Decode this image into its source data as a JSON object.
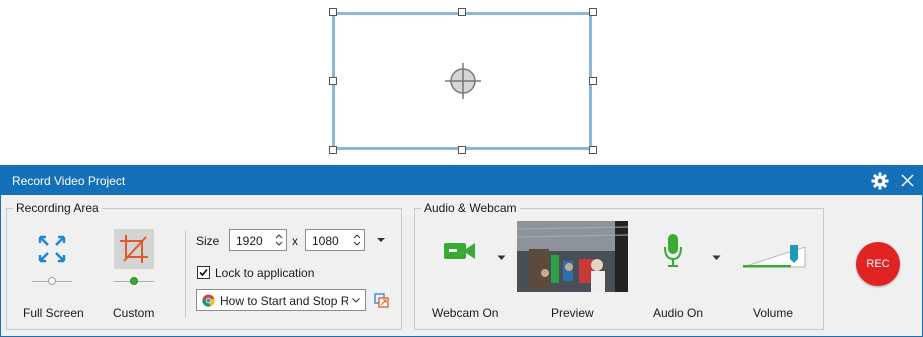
{
  "window": {
    "title": "Record Video Project",
    "settings_icon": "gear-icon",
    "close_icon": "close-icon"
  },
  "recording_area": {
    "group_label": "Recording Area",
    "full_screen_label": "Full Screen",
    "custom_label": "Custom",
    "size_label": "Size",
    "width_value": "1920",
    "x_separator": "x",
    "height_value": "1080",
    "lock_checked": true,
    "lock_label": "Lock to application",
    "app_dropdown_value": "How to Start and Stop Re"
  },
  "audio_webcam": {
    "group_label": "Audio & Webcam",
    "webcam_label": "Webcam On",
    "preview_label": "Preview",
    "audio_label": "Audio On",
    "volume_label": "Volume"
  },
  "rec_button": {
    "label": "REC"
  },
  "colors": {
    "accent": "#1470b8",
    "rec": "#e02424",
    "green": "#3aaa35",
    "custom_icon": "#e0592a"
  }
}
